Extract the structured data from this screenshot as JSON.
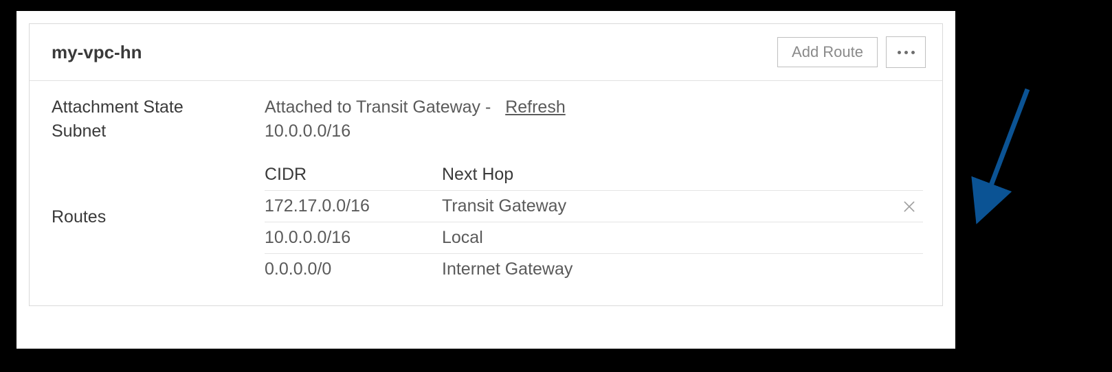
{
  "header": {
    "title": "my-vpc-hn",
    "add_route_label": "Add Route"
  },
  "details": {
    "attachment_state_label": "Attachment State",
    "attachment_state_value": "Attached to Transit Gateway -",
    "refresh_label": "Refresh",
    "subnet_label": "Subnet",
    "subnet_value": "10.0.0.0/16",
    "routes_label": "Routes"
  },
  "routes_table": {
    "columns": {
      "cidr": "CIDR",
      "next_hop": "Next Hop"
    },
    "rows": [
      {
        "cidr": "172.17.0.0/16",
        "next_hop": "Transit Gateway",
        "deletable": true
      },
      {
        "cidr": "10.0.0.0/16",
        "next_hop": "Local",
        "deletable": false
      },
      {
        "cidr": "0.0.0.0/0",
        "next_hop": "Internet Gateway",
        "deletable": false
      }
    ]
  }
}
